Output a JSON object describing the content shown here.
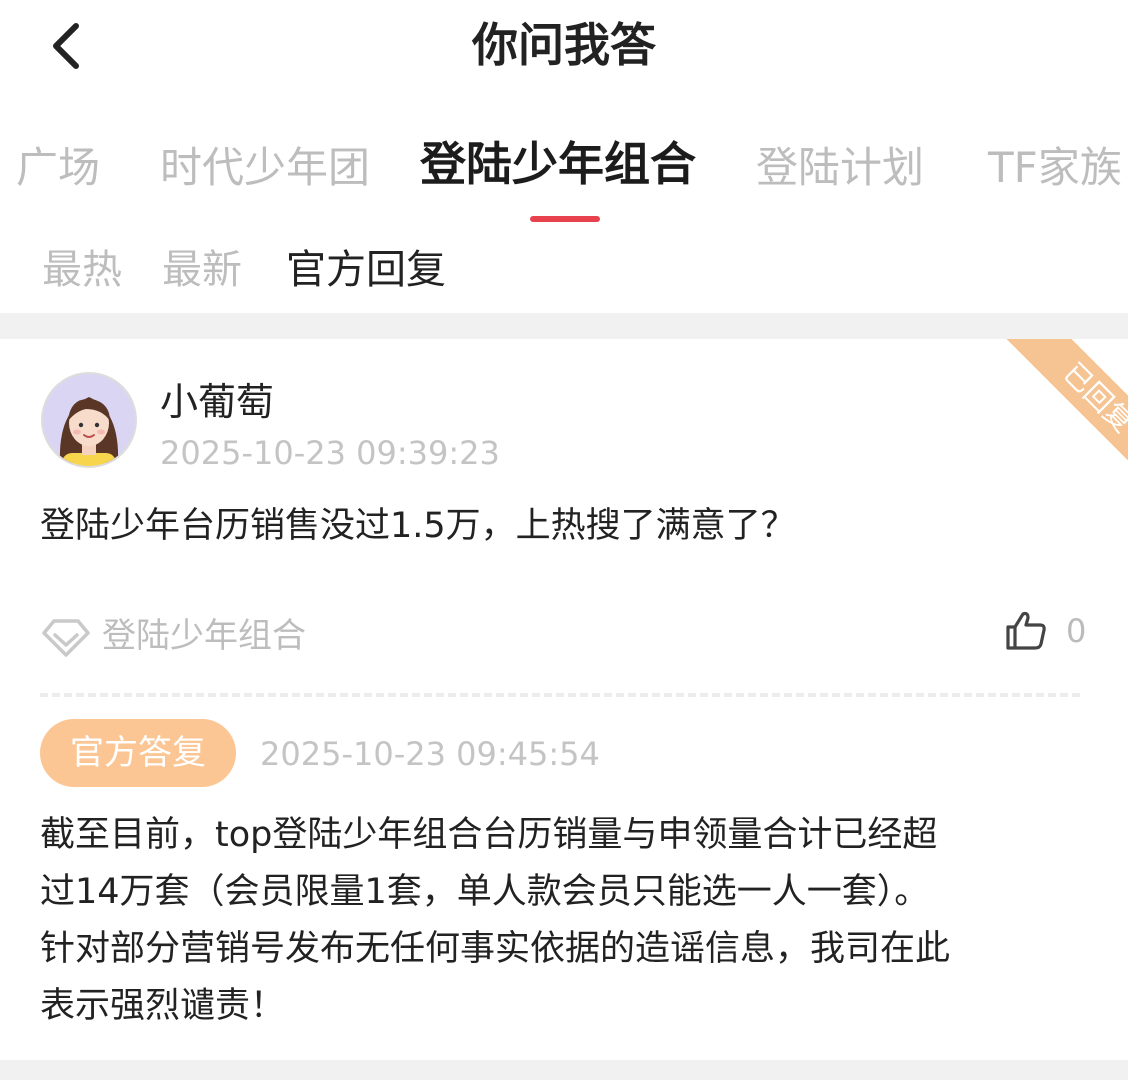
{
  "header": {
    "title": "你问我答"
  },
  "tabs": [
    {
      "label": "广场",
      "active": false
    },
    {
      "label": "时代少年团",
      "active": false
    },
    {
      "label": "登陆少年组合",
      "active": true
    },
    {
      "label": "登陆计划",
      "active": false
    },
    {
      "label": "TF家族",
      "active": false
    }
  ],
  "subtabs": [
    {
      "label": "最热",
      "active": false
    },
    {
      "label": "最新",
      "active": false
    },
    {
      "label": "官方回复",
      "active": true
    }
  ],
  "post": {
    "status_ribbon": "已回复",
    "username": "小葡萄",
    "time": "2025-10-23 09:39:23",
    "question": "登陆少年台历销售没过1.5万，上热搜了满意了？",
    "topic": "登陆少年组合",
    "like_count": "0"
  },
  "reply": {
    "badge": "官方答复",
    "time": "2025-10-23 09:45:54",
    "lines": [
      "截至目前，top登陆少年组合台历销量与申领量合计已经超",
      "过14万套（会员限量1套，单人款会员只能选一人一套）。",
      "针对部分营销号发布无任何事实依据的造谣信息，我司在此",
      "表示强烈谴责！"
    ]
  },
  "colors": {
    "accent_red": "#e8424f",
    "badge_orange": "#fbc693",
    "muted_text": "#bdbdbd"
  },
  "icons": [
    "chevron-left-icon",
    "avatar-girl",
    "diamond-topic-icon",
    "thumbs-up-icon"
  ]
}
